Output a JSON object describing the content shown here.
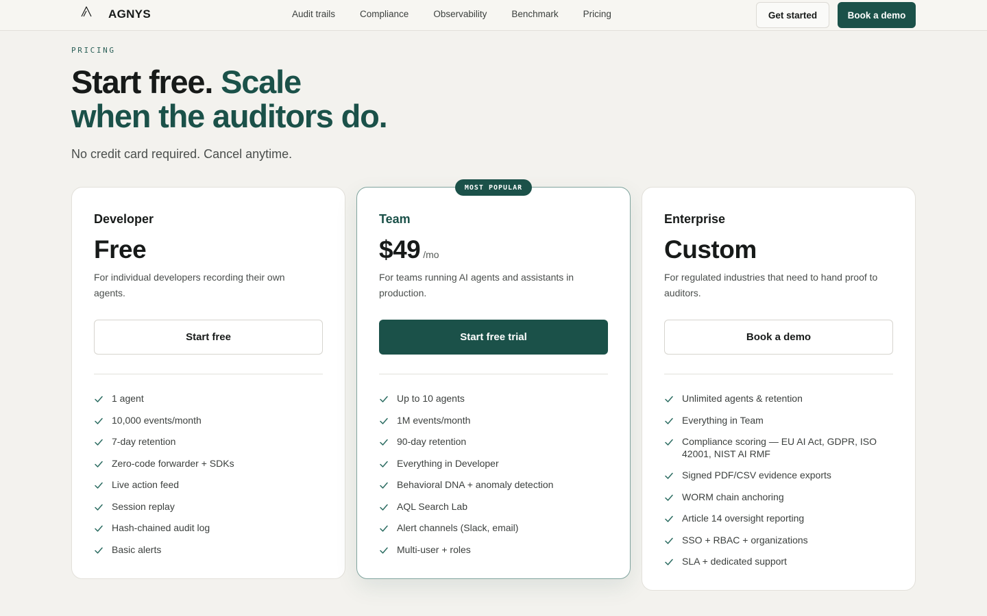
{
  "brand": {
    "name": "AGNYS",
    "icon": "logo-a-icon"
  },
  "nav": {
    "links": [
      "Audit trails",
      "Compliance",
      "Observability",
      "Benchmark",
      "Pricing"
    ],
    "get_started": "Get started",
    "book_demo": "Book a demo"
  },
  "hero": {
    "eyebrow": "PRICING",
    "headline_part1": "Start free.",
    "headline_part2": "Scale",
    "headline_part3": "when the auditors do.",
    "subhead": "No credit card required. Cancel anytime."
  },
  "colors": {
    "accent": "#1b5149",
    "background": "#f3f2ee",
    "card": "#ffffff"
  },
  "plans": [
    {
      "name": "Developer",
      "price": "Free",
      "period": "",
      "description": "For individual developers recording their own agents.",
      "cta": "Start free",
      "features": [
        "1 agent",
        "10,000 events/month",
        "7-day retention",
        "Zero-code forwarder + SDKs",
        "Live action feed",
        "Session replay",
        "Hash-chained audit log",
        "Basic alerts"
      ]
    },
    {
      "name": "Team",
      "badge": "MOST POPULAR",
      "price": "$49",
      "period": "/mo",
      "description": "For teams running AI agents and assistants in production.",
      "cta": "Start free trial",
      "features": [
        "Up to 10 agents",
        "1M events/month",
        "90-day retention",
        "Everything in Developer",
        "Behavioral DNA + anomaly detection",
        "AQL Search Lab",
        "Alert channels (Slack, email)",
        "Multi-user + roles"
      ]
    },
    {
      "name": "Enterprise",
      "price": "Custom",
      "period": "",
      "description": "For regulated industries that need to hand proof to auditors.",
      "cta": "Book a demo",
      "features": [
        "Unlimited agents & retention",
        "Everything in Team",
        "Compliance scoring — EU AI Act, GDPR, ISO 42001, NIST AI RMF",
        "Signed PDF/CSV evidence exports",
        "WORM chain anchoring",
        "Article 14 oversight reporting",
        "SSO + RBAC + organizations",
        "SLA + dedicated support"
      ]
    }
  ]
}
